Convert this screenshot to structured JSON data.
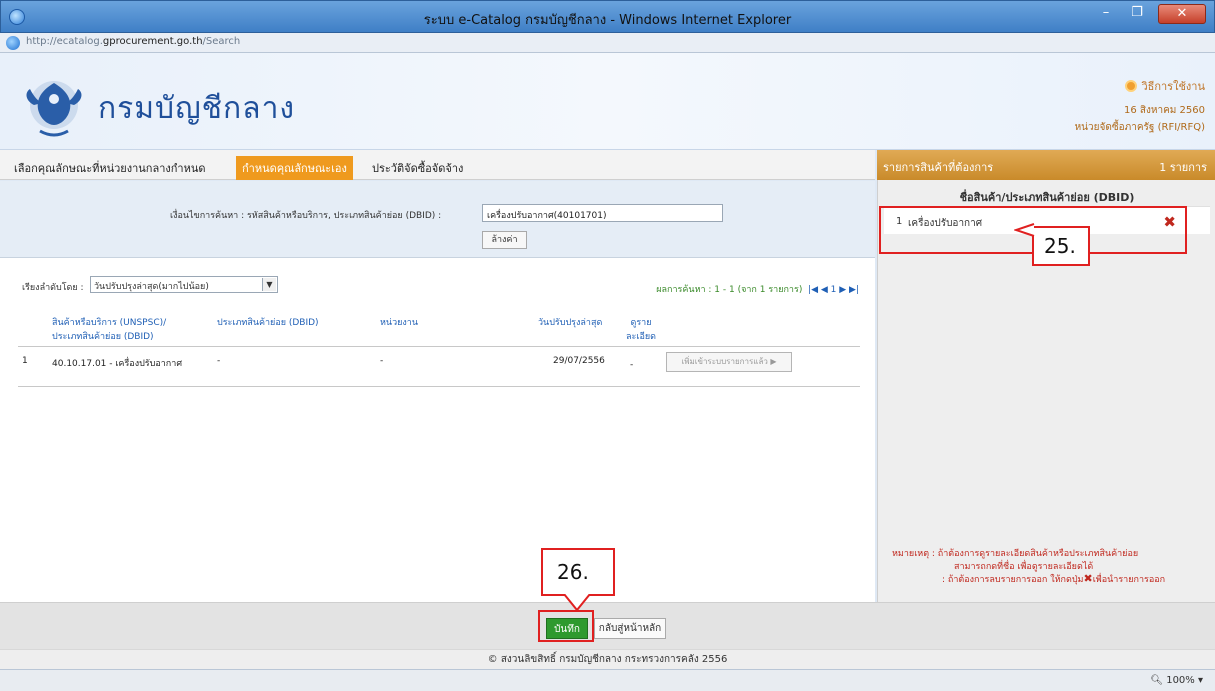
{
  "window": {
    "title": "ระบบ e-Catalog กรมบัญชีกลาง - Windows Internet Explorer",
    "min_glyph": "–",
    "max_glyph": "❐",
    "close_glyph": "✕"
  },
  "address": {
    "url_prefix": "http://ecatalog.",
    "url_domain": "gprocurement.go.th",
    "url_suffix": "/Search"
  },
  "header": {
    "logo_text": "กรมบัญชีกลาง",
    "help_label": "วิธีการใช้งาน",
    "date": "16 สิงหาคม 2560",
    "agency": "หน่วยจัดซื้อภาครัฐ (RFI/RFQ)"
  },
  "tabs": [
    {
      "label": "เลือกคุณลักษณะที่หน่วยงานกลางกำหนด",
      "active": false
    },
    {
      "label": "กำหนดคุณลักษณะเอง",
      "active": true
    },
    {
      "label": "ประวัติจัดซื้อจัดจ้าง",
      "active": false
    }
  ],
  "search": {
    "label": "เงื่อนไขการค้นหา : รหัสสินค้าหรือบริการ, ประเภทสินค้าย่อย (DBID) :",
    "value": "เครื่องปรับอากาศ(40101701)",
    "clear_label": "ล้างค่า"
  },
  "results": {
    "sort_label": "เรียงลำดับโดย :",
    "sort_value": "วันปรับปรุงล่าสุด(มากไปน้อย)",
    "count_text": "ผลการค้นหา : 1 - 1 (จาก 1 รายการ)",
    "pager": "|◀ ◀  1 ▶ ▶|",
    "headers": {
      "item": "สินค้าหรือบริการ (UNSPSC)/ ประเภทสินค้าย่อย (DBID)",
      "subtype": "ประเภทสินค้าย่อย (DBID)",
      "agency": "หน่วยงาน",
      "updated": "วันปรับปรุงล่าสุด",
      "detail": "ดูราย ละเอียด"
    },
    "rows": [
      {
        "num": "1",
        "item": "40.10.17.01 - เครื่องปรับอากาศ",
        "subtype": "-",
        "agency": "-",
        "updated": "29/07/2556",
        "detail": "-",
        "button": "เพิ่มเข้าระบบรายการแล้ว ▶"
      }
    ]
  },
  "cart": {
    "title": "รายการสินค้าที่ต้องการ",
    "count": "1 รายการ",
    "column_header": "ชื่อสินค้า/ประเภทสินค้าย่อย (DBID)",
    "items": [
      {
        "num": "1",
        "name": "เครื่องปรับอากาศ"
      }
    ],
    "delete_glyph": "✖",
    "note_line1": "หมายเหตุ : ถ้าต้องการดูรายละเอียดสินค้าหรือประเภทสินค้าย่อย",
    "note_line2": "สามารถกดที่ชื่อ เพื่อดูรายละเอียดได้",
    "note_line3a": ": ถ้าต้องการลบรายการออก ให้กดปุ่ม",
    "note_line3b": "เพื่อนำรายการออก"
  },
  "buttons": {
    "save": "บันทึก",
    "back": "กลับสู่หน้าหลัก"
  },
  "footer": "© สงวนลิขสิทธิ์ กรมบัญชีกลาง กระทรวงการคลัง 2556",
  "status": {
    "zoom": "100%"
  },
  "callouts": {
    "c25": "25.",
    "c26": "26."
  },
  "colors": {
    "active_tab": "#ef9a1e",
    "cart_header": "#c98a2a",
    "save_button": "#2e9a2e",
    "callout": "#e02020"
  }
}
